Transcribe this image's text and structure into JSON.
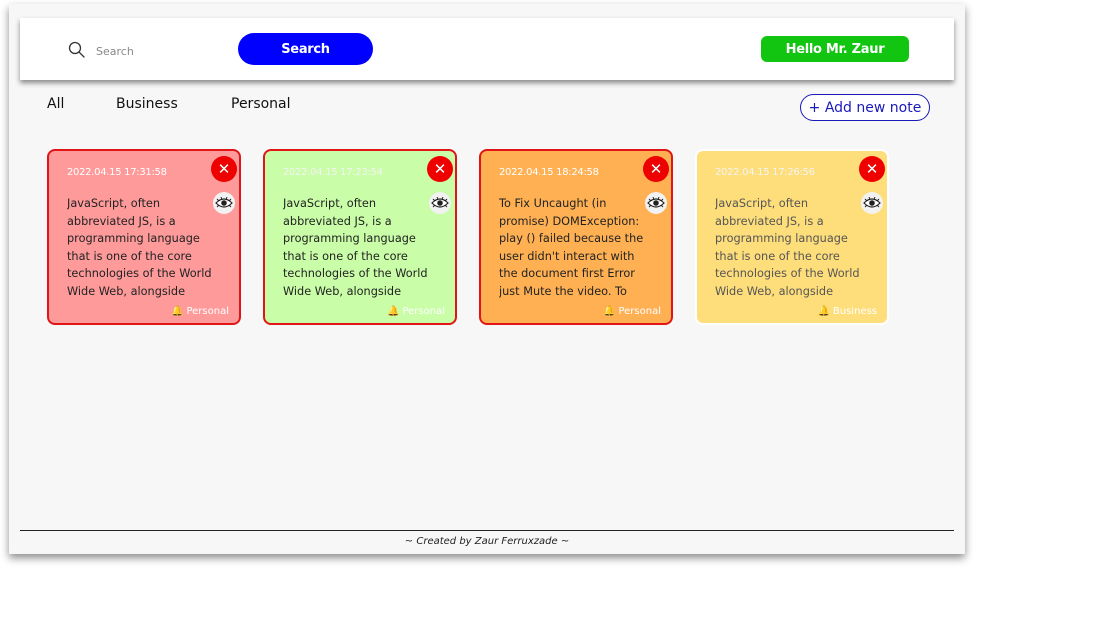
{
  "header": {
    "search_placeholder": "Search",
    "search_button": "Search",
    "greeting": "Hello Mr. Zaur"
  },
  "filters": [
    "All",
    "Business",
    "Personal"
  ],
  "add_note_label": "+ Add new note",
  "notes": [
    {
      "date": "2022.04.15 17:31:58",
      "text": "JavaScript, often abbreviated JS, is a programming language that is one of the core technologies of the World Wide Web, alongside HTML",
      "category": "Personal",
      "color": "#fe9a9a"
    },
    {
      "date": "2022.04.15 17:23:54",
      "text": "JavaScript, often abbreviated JS, is a programming language that is one of the core technologies of the World Wide Web, alongside HTML",
      "category": "Personal",
      "color": "#c9fda7"
    },
    {
      "date": "2022.04.15 18:24:58",
      "text": "To Fix Uncaught (in promise) DOMException: play () failed because the user didn't interact with the document first Error just Mute the video. To solve this",
      "category": "Personal",
      "color": "#feb053"
    },
    {
      "date": "2022.04.15 17:26:56",
      "text": "JavaScript, often abbreviated JS, is a programming language that is one of the core technologies of the World Wide Web, alongside HTML",
      "category": "Business",
      "color": "#fede7b"
    }
  ],
  "icons": {
    "close": "close-icon",
    "view": "eye-icon",
    "tag": "bell-icon",
    "search": "search-icon"
  },
  "footer": "~ Created by Zaur Ferruxzade ~"
}
